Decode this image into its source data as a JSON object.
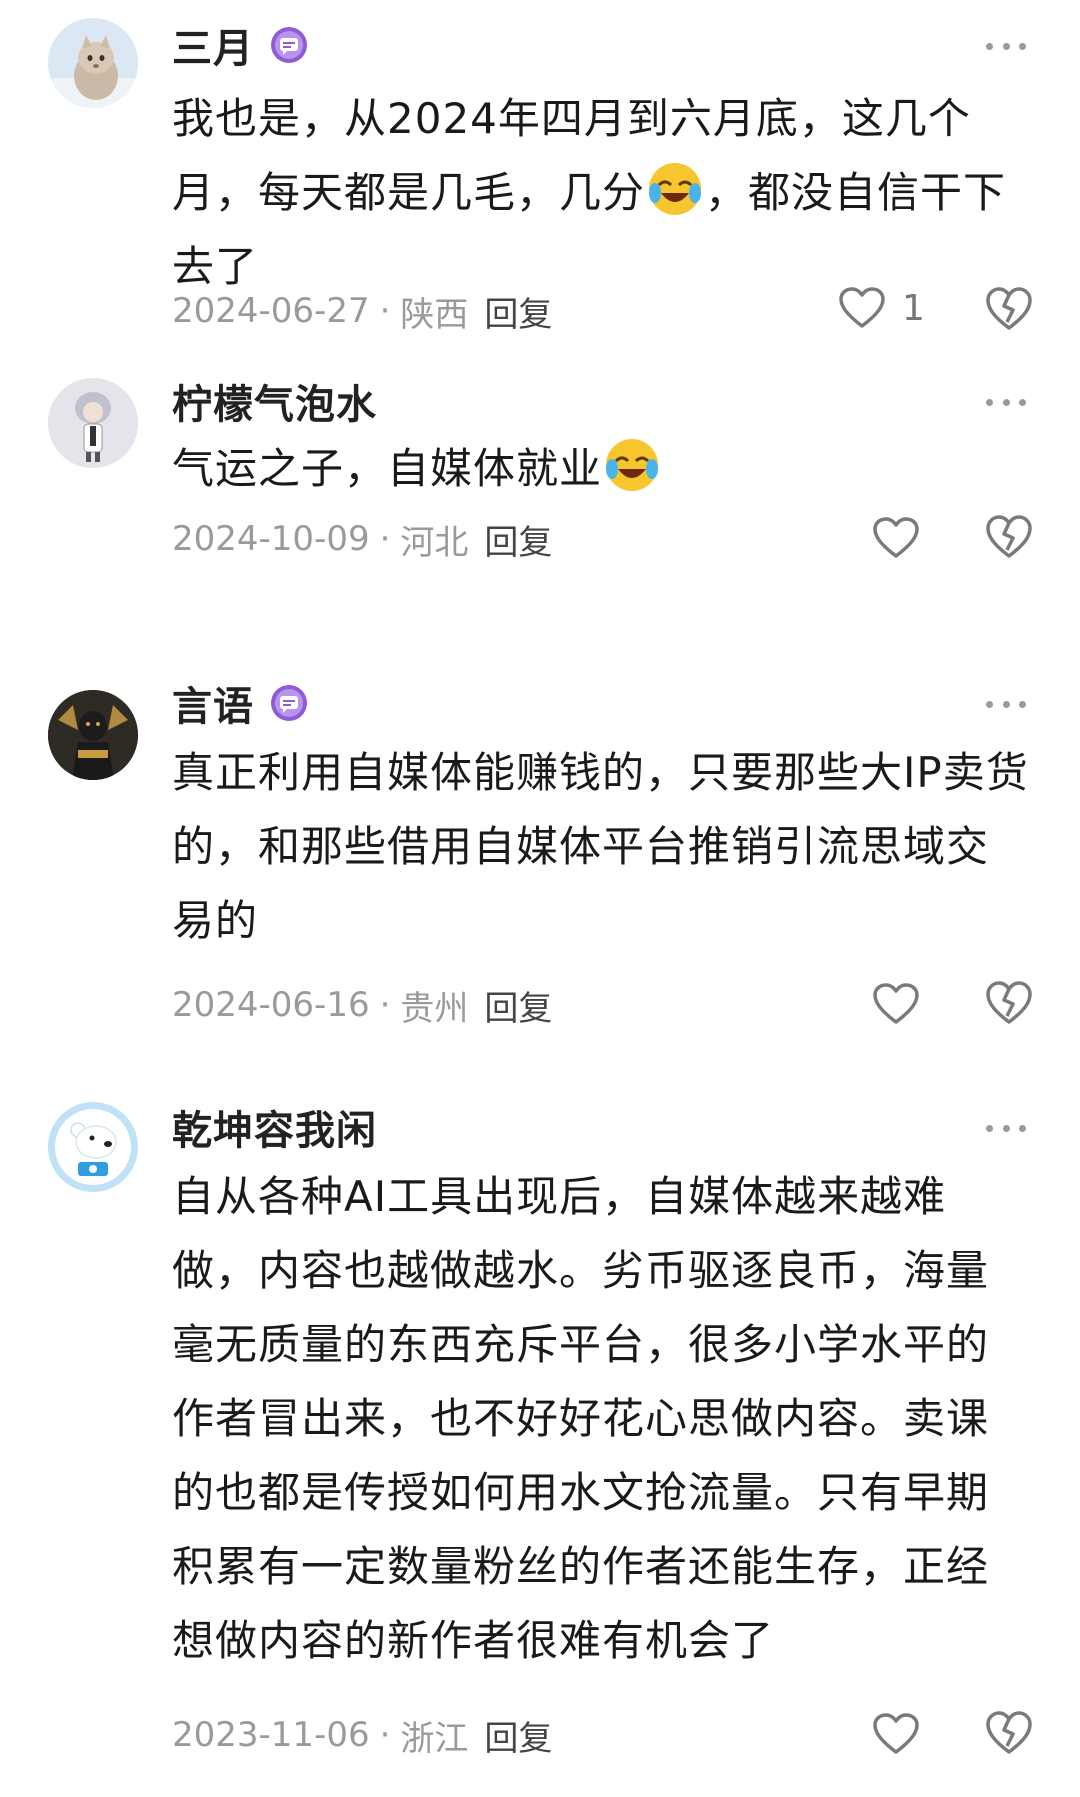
{
  "comments": [
    {
      "username": "三月",
      "has_vip_badge": true,
      "avatar": "kitten-avatar",
      "text_before_emoji": "我也是，从2024年四月到六月底，这几个月，每天都是几毛，几分",
      "emoji": "crying-laughing-emoji",
      "text_after_emoji": "，都没自信干下去了",
      "date": "2024-06-27",
      "separator": "·",
      "location": "陕西",
      "reply_label": "回复",
      "like_count": "1"
    },
    {
      "username": "柠檬气泡水",
      "has_vip_badge": false,
      "avatar": "anime-character-avatar",
      "text_before_emoji": "气运之子，自媒体就业",
      "emoji": "crying-laughing-emoji",
      "text_after_emoji": "",
      "date": "2024-10-09",
      "separator": "·",
      "location": "河北",
      "reply_label": "回复",
      "like_count": ""
    },
    {
      "username": "言语",
      "has_vip_badge": true,
      "avatar": "dark-figure-avatar",
      "text_before_emoji": "真正利用自媒体能赚钱的，只要那些大IP卖货的，和那些借用自媒体平台推销引流思域交易的",
      "emoji": "",
      "text_after_emoji": "",
      "date": "2024-06-16",
      "separator": "·",
      "location": "贵州",
      "reply_label": "回复",
      "like_count": ""
    },
    {
      "username": "乾坤容我闲",
      "has_vip_badge": false,
      "avatar": "polar-bear-avatar",
      "text_before_emoji": "自从各种AI工具出现后，自媒体越来越难做，内容也越做越水。劣币驱逐良币，海量毫无质量的东西充斥平台，很多小学水平的作者冒出来，也不好好花心思做内容。卖课的也都是传授如何用水文抢流量。只有早期积累有一定数量粉丝的作者还能生存，正经想做内容的新作者很难有机会了",
      "emoji": "",
      "text_after_emoji": "",
      "date": "2023-11-06",
      "separator": "·",
      "location": "浙江",
      "reply_label": "回复",
      "like_count": ""
    }
  ],
  "colors": {
    "text": "#1a1a1a",
    "meta": "#9a9a9a",
    "vip_badge": "#8f5bd6",
    "icon_stroke": "#7a7a7a"
  }
}
